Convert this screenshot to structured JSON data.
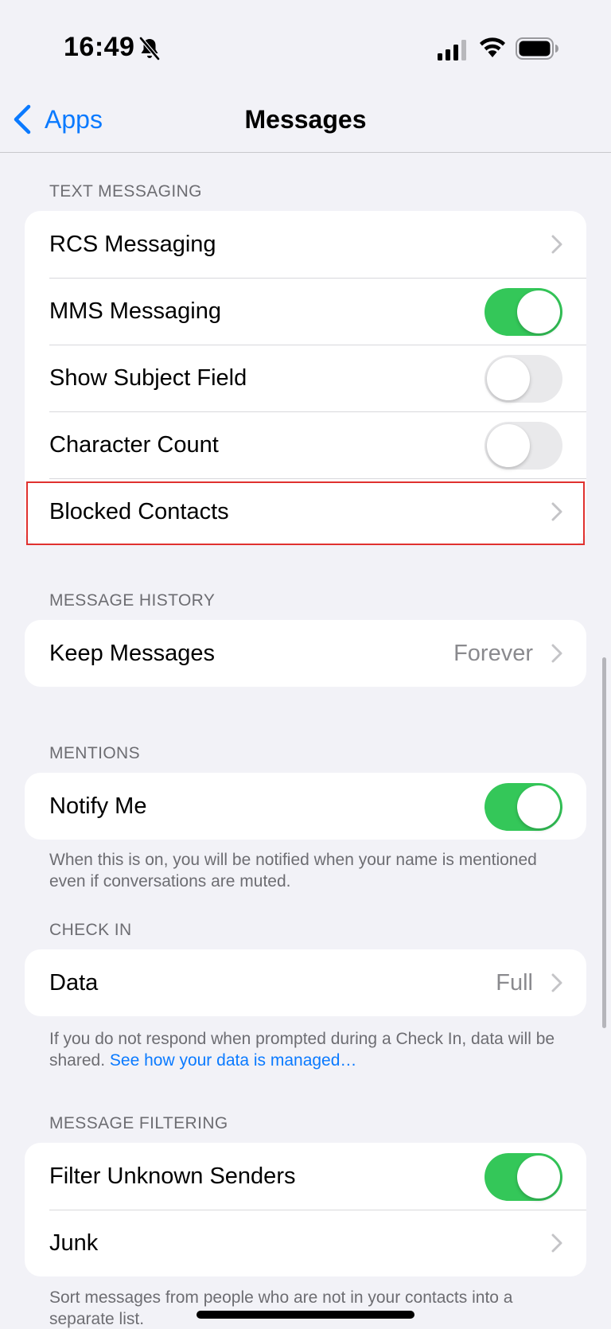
{
  "status_bar": {
    "time": "16:49",
    "icons": [
      "bell-slash-icon",
      "cellular-signal-icon",
      "wifi-icon",
      "battery-icon"
    ]
  },
  "nav": {
    "back_label": "Apps",
    "title": "Messages"
  },
  "text_messaging": {
    "header": "TEXT MESSAGING",
    "rows": [
      {
        "label": "RCS Messaging",
        "type": "chevron"
      },
      {
        "label": "MMS Messaging",
        "type": "toggle",
        "on": true
      },
      {
        "label": "Show Subject Field",
        "type": "toggle",
        "on": false
      },
      {
        "label": "Character Count",
        "type": "toggle",
        "on": false
      },
      {
        "label": "Blocked Contacts",
        "type": "chevron",
        "highlighted": true
      }
    ]
  },
  "message_history": {
    "header": "MESSAGE HISTORY",
    "keep_messages": {
      "label": "Keep Messages",
      "value": "Forever"
    }
  },
  "mentions": {
    "header": "MENTIONS",
    "notify_me": {
      "label": "Notify Me",
      "on": true
    },
    "footer": "When this is on, you will be notified when your name is mentioned even if conversations are muted."
  },
  "check_in": {
    "header": "CHECK IN",
    "data_row": {
      "label": "Data",
      "value": "Full"
    },
    "footer_text": "If you do not respond when prompted during a Check In, data will be shared.",
    "footer_link": "See how your data is managed…"
  },
  "message_filtering": {
    "header": "MESSAGE FILTERING",
    "filter_unknown": {
      "label": "Filter Unknown Senders",
      "on": true
    },
    "junk": {
      "label": "Junk"
    },
    "footer": "Sort messages from people who are not in your contacts into a separate list."
  },
  "colors": {
    "accent": "#0a7aff",
    "toggle_on": "#34c759",
    "highlight": "#e0312f",
    "background": "#f2f2f7"
  }
}
